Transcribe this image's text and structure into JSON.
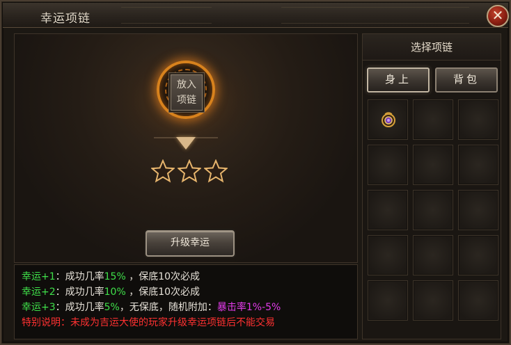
{
  "window": {
    "title": "幸运项链",
    "close_label": "✕"
  },
  "main": {
    "slot_label_line1": "放入",
    "slot_label_line2": "项链",
    "stars": 3,
    "upgrade_button": "升级幸运"
  },
  "info": {
    "line1": {
      "tag": "幸运+1",
      "sep": "：",
      "text1": "成功几率",
      "rate": "15%",
      "text2": " ，保底10次必成"
    },
    "line2": {
      "tag": "幸运+2",
      "sep": "：",
      "text1": "成功几率",
      "rate": "10%",
      "text2": " ，保底10次必成"
    },
    "line3": {
      "tag": "幸运+3",
      "sep": "：",
      "text1": "成功几率",
      "rate": "5%",
      "text2": "，无保底，随机附加：",
      "bonus": "暴击率1%-5%"
    },
    "line4": {
      "text": "特别说明：未成为吉运大使的玩家升级幸运项链后不能交易"
    }
  },
  "side": {
    "title": "选择项链",
    "tabs": [
      "身上",
      "背包"
    ],
    "active_tab": "身上",
    "slots": 15,
    "filled_slot_index": 0,
    "filled_item_icon": "amulet-icon"
  },
  "colors": {
    "lucky_green": "#3fe04a",
    "bonus_purple": "#e23bea",
    "warning_red": "#ff3131",
    "ring_orange": "#d8821d"
  }
}
